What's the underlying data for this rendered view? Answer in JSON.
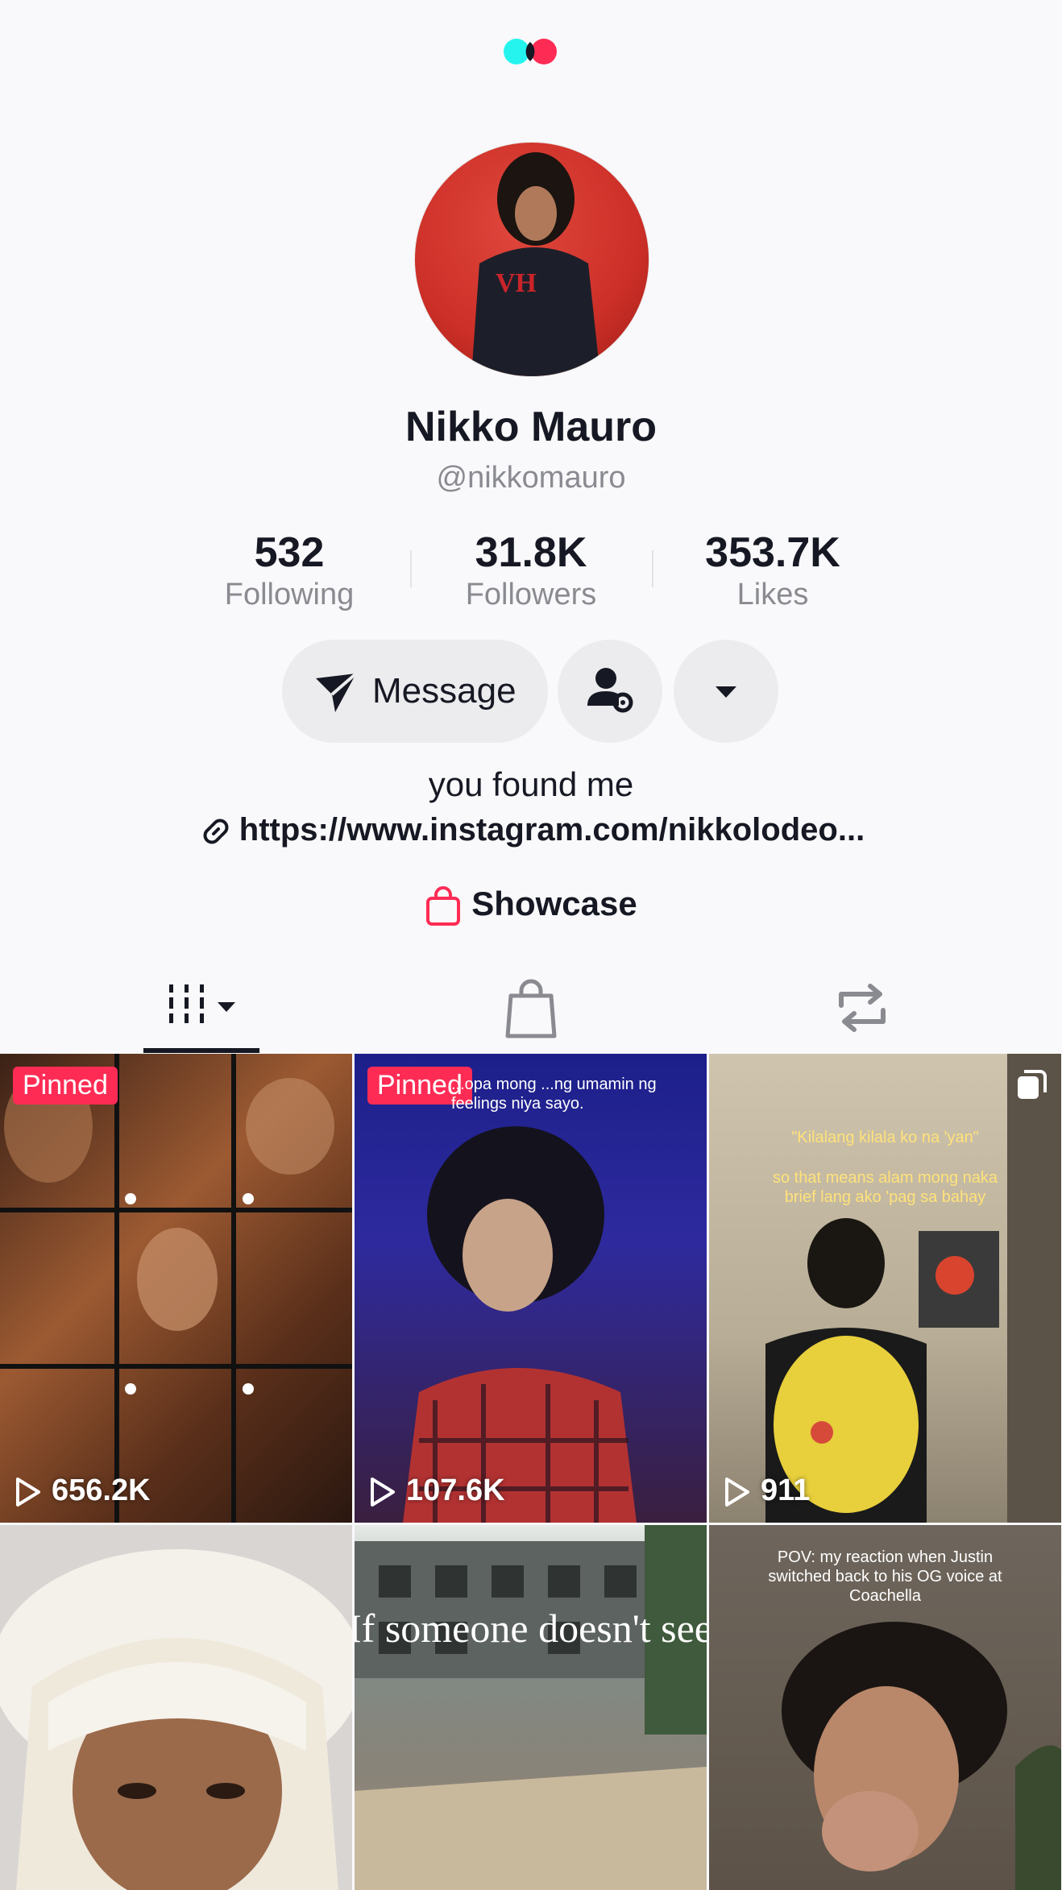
{
  "profile": {
    "name": "Nikko Mauro",
    "handle": "@nikkomauro",
    "bio": "you found me",
    "link": "https://www.instagram.com/nikkolodeo...",
    "showcase": "Showcase"
  },
  "stats": [
    {
      "value": "532",
      "label": "Following"
    },
    {
      "value": "31.8K",
      "label": "Followers"
    },
    {
      "value": "353.7K",
      "label": "Likes"
    }
  ],
  "actions": {
    "message": "Message"
  },
  "tabs": [
    "videos",
    "shop",
    "reposts"
  ],
  "videos": [
    {
      "pinned": "Pinned",
      "views": "656.2K"
    },
    {
      "pinned": "Pinned",
      "views": "107.6K",
      "caption": "...opa mong ...ng umamin ng feelings niya sayo."
    },
    {
      "views": "911",
      "caption1": "\"Kilalang kilala ko na 'yan\"",
      "caption2": "so that means alam mong naka brief lang ako 'pag sa bahay"
    },
    {},
    {
      "caption": "If someone doesn't see"
    },
    {
      "caption": "POV: my reaction when Justin switched back to his OG voice at Coachella"
    }
  ],
  "colors": {
    "accent": "#fe2c55",
    "logo_cyan": "#25f4ee",
    "logo_red": "#fe2c55"
  }
}
